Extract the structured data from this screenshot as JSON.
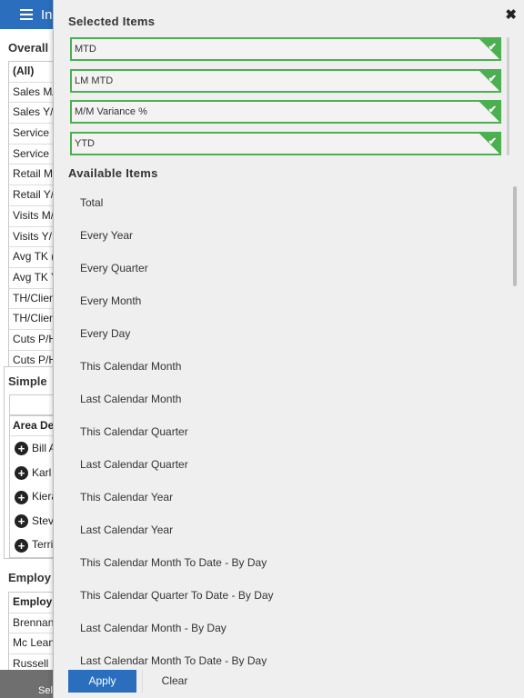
{
  "background": {
    "app_title": "In",
    "sections": {
      "overall": "Overall",
      "simple": "Simple",
      "employees": "Employ"
    },
    "overall_rows": [
      "(All)",
      "Sales M/",
      "Sales Y/",
      "Service",
      "Service",
      "Retail M",
      "Retail Y/",
      "Visits M/",
      "Visits Y/",
      "Avg TK (",
      "Avg TK Y",
      "TH/Clien",
      "TH/Clien",
      "Cuts P/H",
      "Cuts P/H"
    ],
    "simple_header": "Area De",
    "simple_rows": [
      "Bill A",
      "Karl",
      "Kiera",
      "Stev",
      "Terri"
    ],
    "employee_header": "Employ",
    "employee_rows": [
      "Brennan",
      "Mc Lean",
      "Russell"
    ],
    "bottom_label": "Sel"
  },
  "dialog": {
    "selected_heading": "Selected Items",
    "selected_items": [
      "MTD",
      "LM MTD",
      "M/M Variance %",
      "YTD"
    ],
    "available_heading": "Available Items",
    "available_items": [
      "Total",
      "Every Year",
      "Every Quarter",
      "Every Month",
      "Every Day",
      "This Calendar Month",
      "Last Calendar Month",
      "This Calendar Quarter",
      "Last Calendar Quarter",
      "This Calendar Year",
      "Last Calendar Year",
      "This Calendar Month To Date - By Day",
      "This Calendar Quarter To Date - By Day",
      "Last Calendar Month - By Day",
      "Last Calendar Month To Date - By Day"
    ],
    "apply_label": "Apply",
    "clear_label": "Clear",
    "close_glyph": "✖"
  },
  "colors": {
    "accent": "#2a6ebd",
    "selected_border": "#4caf50",
    "panel_bg": "#efefef"
  }
}
